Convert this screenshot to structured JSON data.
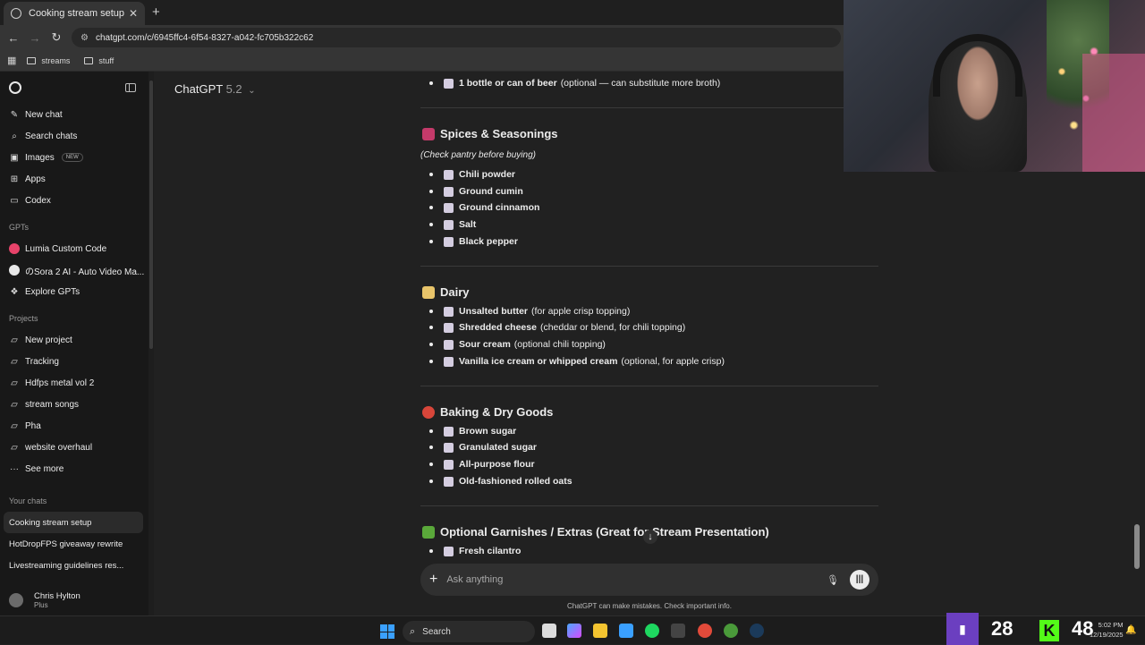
{
  "browser": {
    "tab_title": "Cooking stream setup",
    "tab_close": "✕",
    "new_tab": "+",
    "url": "chatgpt.com/c/6945ffc4-6f54-8327-a042-fc705b322c62",
    "bookmarks": [
      "streams",
      "stuff"
    ]
  },
  "sidebar": {
    "nav": [
      {
        "label": "New chat",
        "icon": "edit-icon"
      },
      {
        "label": "Search chats",
        "icon": "search-icon"
      },
      {
        "label": "Images",
        "icon": "image-icon",
        "badge": "NEW"
      },
      {
        "label": "Apps",
        "icon": "apps-icon"
      },
      {
        "label": "Codex",
        "icon": "codex-icon"
      }
    ],
    "gpts_heading": "GPTs",
    "gpts": [
      {
        "label": "Lumia Custom Code",
        "color": "#e8436a"
      },
      {
        "label": "のSora 2 AI - Auto Video Ma...",
        "color": "#e8e8e8"
      },
      {
        "label": "Explore GPTs",
        "color": ""
      }
    ],
    "projects_heading": "Projects",
    "projects": [
      "New project",
      "Tracking",
      "Hdfps metal vol 2",
      "stream songs",
      "Pha",
      "website overhaul",
      "See more"
    ],
    "chats_heading": "Your chats",
    "chats": [
      "Cooking stream setup",
      "HotDropFPS giveaway rewrite",
      "Livestreaming guidelines res..."
    ],
    "user": {
      "name": "Chris Hylton",
      "plan": "Plus"
    }
  },
  "main": {
    "model_name": "ChatGPT",
    "model_version": "5.2",
    "top_item": {
      "bold": "1 bottle or can of beer",
      "rest": "(optional — can substitute more broth)"
    },
    "sections": [
      {
        "title": "Spices & Seasonings",
        "emoji_color": "#c43a6a",
        "note": "(Check pantry before buying)",
        "items": [
          {
            "bold": "Chili powder",
            "rest": ""
          },
          {
            "bold": "Ground cumin",
            "rest": ""
          },
          {
            "bold": "Ground cinnamon",
            "rest": ""
          },
          {
            "bold": "Salt",
            "rest": ""
          },
          {
            "bold": "Black pepper",
            "rest": ""
          }
        ]
      },
      {
        "title": "Dairy",
        "emoji_color": "#e8c46a",
        "items": [
          {
            "bold": "Unsalted butter",
            "rest": "(for apple crisp topping)"
          },
          {
            "bold": "Shredded cheese",
            "rest": "(cheddar or blend, for chili topping)"
          },
          {
            "bold": "Sour cream",
            "rest": "(optional chili topping)"
          },
          {
            "bold": "Vanilla ice cream or whipped cream",
            "rest": "(optional, for apple crisp)"
          }
        ]
      },
      {
        "title": "Baking & Dry Goods",
        "emoji_color": "#d8463a",
        "items": [
          {
            "bold": "Brown sugar",
            "rest": ""
          },
          {
            "bold": "Granulated sugar",
            "rest": ""
          },
          {
            "bold": "All-purpose flour",
            "rest": ""
          },
          {
            "bold": "Old-fashioned rolled oats",
            "rest": ""
          }
        ]
      },
      {
        "title": "Optional Garnishes / Extras (Great for Stream Presentation)",
        "emoji_color": "#5aa83a",
        "items": [
          {
            "bold": "Fresh cilantro",
            "rest": ""
          }
        ]
      }
    ],
    "composer_placeholder": "Ask anything",
    "disclaimer": "ChatGPT can make mistakes. Check important info."
  },
  "taskbar": {
    "search_label": "Search",
    "twitch_count": "28",
    "kick_count": "48",
    "time": "5:02 PM",
    "date": "12/19/2025"
  }
}
